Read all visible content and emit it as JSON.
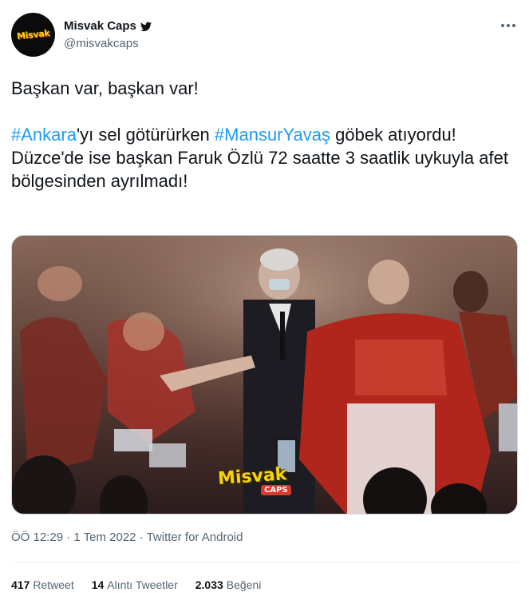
{
  "author": {
    "display_name": "Misvak Caps",
    "handle": "@misvakcaps",
    "avatar_text": "Misvak"
  },
  "tweet": {
    "line1": "Başkan var, başkan var!",
    "hashtag1": "#Ankara",
    "text_mid": "'yı sel götürürken ",
    "hashtag2": "#MansurYavaş",
    "text_after": " göbek atıyordu!",
    "line3": "Düzce'de ise başkan Faruk Özlü 72 saatte 3 saatlik uykuyla afet bölgesinden ayrılmadı!"
  },
  "media": {
    "watermark_main": "Misvak",
    "watermark_sub": "CAPS"
  },
  "meta": {
    "time": "ÖÖ 12:29",
    "date": "1 Tem 2022",
    "source": "Twitter for Android",
    "sep": "·"
  },
  "stats": {
    "retweets_count": "417",
    "retweets_label": "Retweet",
    "quotes_count": "14",
    "quotes_label": "Alıntı Tweetler",
    "likes_count": "2.033",
    "likes_label": "Beğeni"
  },
  "colors": {
    "accent": "#1d9bf0",
    "secondary_text": "#536471"
  },
  "icons": [
    "verified-badge-icon",
    "more-options-icon"
  ]
}
